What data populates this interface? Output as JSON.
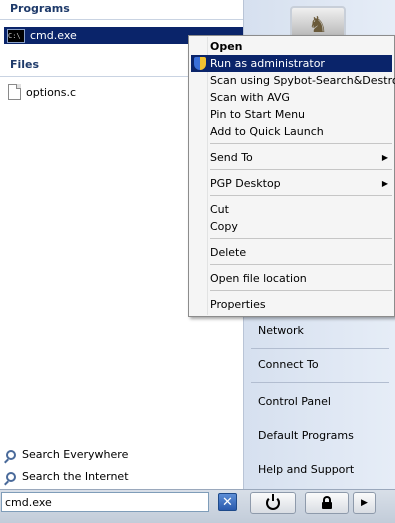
{
  "left_pane": {
    "programs_header": "Programs",
    "program_item": "cmd.exe",
    "files_header": "Files",
    "file_item": "options.c",
    "search_everywhere": "Search Everywhere",
    "search_internet": "Search the Internet"
  },
  "search": {
    "value": "cmd.exe",
    "clear_icon": "✕"
  },
  "right_pane": {
    "items": [
      "Network",
      "Connect To",
      "Control Panel",
      "Default Programs",
      "Help and Support"
    ]
  },
  "context_menu": {
    "open": "Open",
    "run_as_admin": "Run as administrator",
    "scan_spybot": "Scan using Spybot-Search&Destroy",
    "scan_avg": "Scan with AVG",
    "pin_start": "Pin to Start Menu",
    "add_quick_launch": "Add to Quick Launch",
    "send_to": "Send To",
    "pgp_desktop": "PGP Desktop",
    "cut": "Cut",
    "copy": "Copy",
    "delete": "Delete",
    "open_file_location": "Open file location",
    "properties": "Properties",
    "submenu_arrow": "▶"
  },
  "buttons": {
    "arrow": "▶"
  },
  "colors": {
    "highlight": "#0a246a",
    "right_pane": "#dfe7f2"
  }
}
